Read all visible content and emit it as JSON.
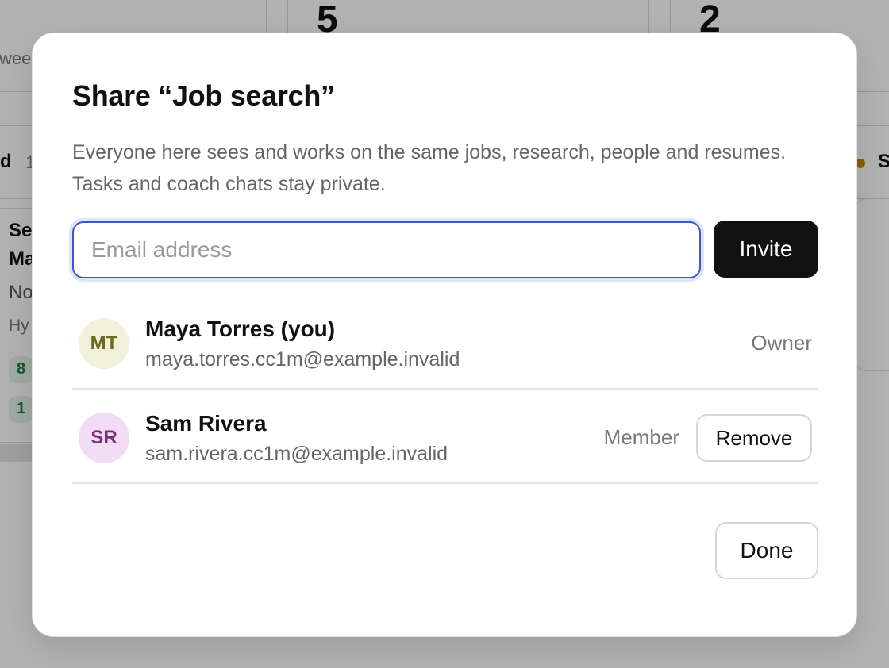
{
  "background": {
    "stats": [
      {
        "value": "5",
        "sub": ""
      },
      {
        "value": "2",
        "sub": ""
      }
    ],
    "week_fragment": "wee",
    "column_left_fragment": "d",
    "column_left_count_fragment": "1",
    "column_right_fragment": "S",
    "card_lines": [
      "Se",
      "Ma",
      "No",
      "Hy"
    ],
    "card_pills": [
      "8",
      "1"
    ],
    "status_dot_color": "#c58a00"
  },
  "modal": {
    "title": "Share “Job search”",
    "description": "Everyone here sees and works on the same jobs, research, people and resumes. Tasks and coach chats stay private.",
    "email_placeholder": "Email address",
    "email_value": "",
    "invite_label": "Invite",
    "members": [
      {
        "initials": "MT",
        "name": "Maya Torres (you)",
        "email": "maya.torres.cc1m@example.invalid",
        "role": "Owner"
      },
      {
        "initials": "SR",
        "name": "Sam Rivera",
        "email": "sam.rivera.cc1m@example.invalid",
        "role": "Member",
        "remove_label": "Remove"
      }
    ],
    "done_label": "Done"
  },
  "colors": {
    "accent": "#3b57c9",
    "primary_button": "#111111",
    "avatar_mt_bg": "#f1f1da",
    "avatar_sr_bg": "#f1dcf4"
  }
}
